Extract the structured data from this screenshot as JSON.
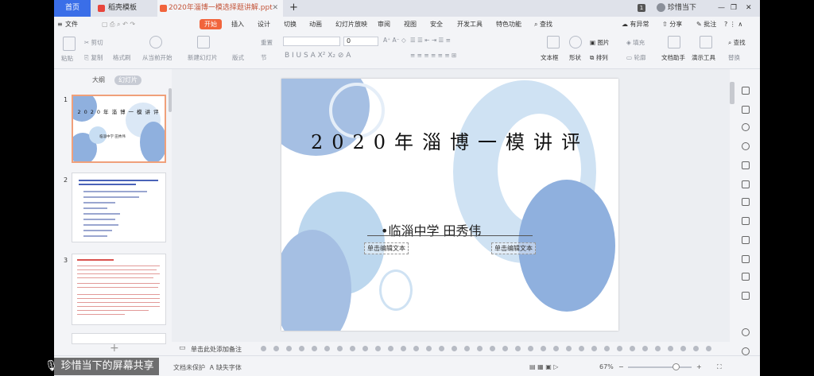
{
  "tabs": {
    "home": "首页",
    "template": "稻壳模板",
    "document": "2020年淄博一模选择题讲解.ppt",
    "user": "珍惜当下"
  },
  "menu": [
    "文件",
    "开始",
    "插入",
    "设计",
    "切换",
    "动画",
    "幻灯片放映",
    "审阅",
    "视图",
    "安全",
    "开发工具",
    "特色功能",
    "查找"
  ],
  "menu_right": [
    "有异常",
    "分享",
    "批注"
  ],
  "ribbon": {
    "cut": "剪切",
    "copy": "复制",
    "format_painter": "格式刷",
    "paste": "粘贴",
    "play": "从当前开始",
    "new_slide": "新建幻灯片",
    "layout": "版式",
    "section": "节",
    "reset": "重置",
    "font_size": "0",
    "textbox": "文本框",
    "shape": "形状",
    "picture": "图片",
    "arrange": "排列",
    "fill": "填充",
    "outline": "轮廓",
    "doc_assist": "文档助手",
    "presentation_tools": "演示工具",
    "find": "查找",
    "replace": "替换"
  },
  "left_panel": {
    "outline_tab": "大纲",
    "slides_tab": "幻灯片",
    "slide_numbers": [
      "1",
      "2",
      "3"
    ],
    "add": "+"
  },
  "slide": {
    "title": "2020年淄博一模讲评",
    "subtitle": "•临淄中学    田秀伟",
    "placeholder_left": "单击编辑文本",
    "placeholder_right": "单击编辑文本",
    "thumb1_title": "2020年淄博一模讲评",
    "thumb1_sub": "临淄中学  田秀伟"
  },
  "notes": {
    "placeholder": "单击此处添加备注"
  },
  "status": {
    "backup": "文档未保护",
    "font": "缺失字体",
    "zoom": "67%"
  },
  "overlay": {
    "text": "珍惜当下的屏幕共享"
  },
  "colors": {
    "accent": "#f1643c",
    "blue_tab": "#3a6ee8",
    "circle_dark": "#8fb0de",
    "circle_light": "#c8def3"
  }
}
